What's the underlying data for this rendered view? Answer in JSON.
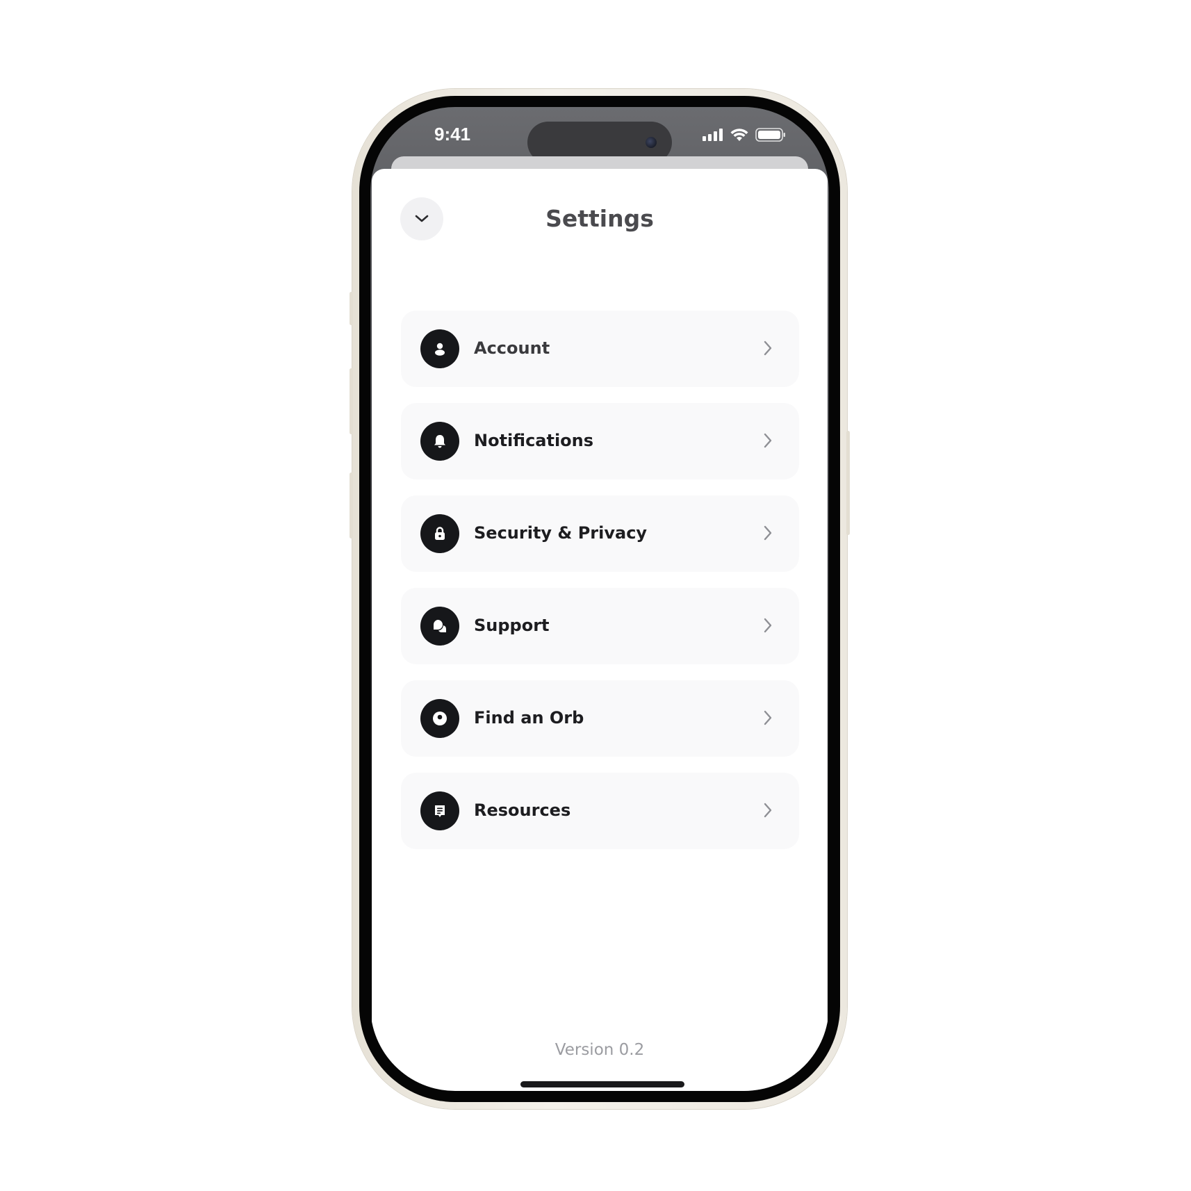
{
  "status_bar": {
    "time": "9:41",
    "icons": [
      "cellular-signal-icon",
      "wifi-icon",
      "battery-icon"
    ]
  },
  "header": {
    "title": "Settings",
    "collapse_icon": "chevron-down-icon"
  },
  "menu": {
    "items": [
      {
        "label": "Account",
        "icon": "user-icon"
      },
      {
        "label": "Notifications",
        "icon": "bell-icon"
      },
      {
        "label": "Security & Privacy",
        "icon": "lock-icon"
      },
      {
        "label": "Support",
        "icon": "chat-bubbles-icon"
      },
      {
        "label": "Find an Orb",
        "icon": "orb-icon"
      },
      {
        "label": "Resources",
        "icon": "document-icon"
      }
    ],
    "trailing_icon": "chevron-right-icon"
  },
  "footer": {
    "version": "Version 0.2"
  },
  "colors": {
    "icon_background": "#16171a",
    "row_background": "#f9f9fa",
    "title_text": "#4a4a4e",
    "version_text": "#9b9ca1"
  }
}
